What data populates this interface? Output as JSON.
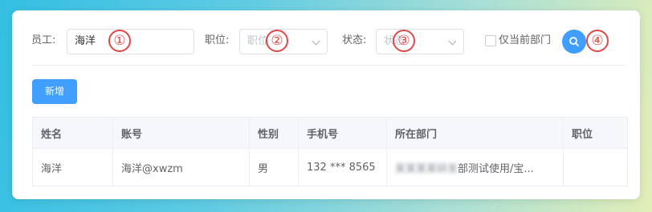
{
  "filters": {
    "employee_label": "员工:",
    "employee_value": "海洋",
    "position_label": "职位:",
    "position_placeholder": "职位",
    "status_label": "状态:",
    "status_placeholder": "状态",
    "current_dept_only_label": "仅当前部门"
  },
  "annotations": [
    "①",
    "②",
    "③",
    "④"
  ],
  "toolbar": {
    "add_label": "新增"
  },
  "table": {
    "columns": [
      "姓名",
      "账号",
      "性别",
      "手机号",
      "所在部门",
      "职位"
    ],
    "rows": [
      {
        "name": "海洋",
        "account": "海洋@xwzm",
        "gender": "男",
        "phone": "132 *** 8565",
        "dept_redacted": "某某某某研发",
        "dept_visible": "部测试使用/宝...",
        "position": ""
      }
    ]
  },
  "colors": {
    "accent": "#409eff",
    "annotation": "#e04848"
  }
}
